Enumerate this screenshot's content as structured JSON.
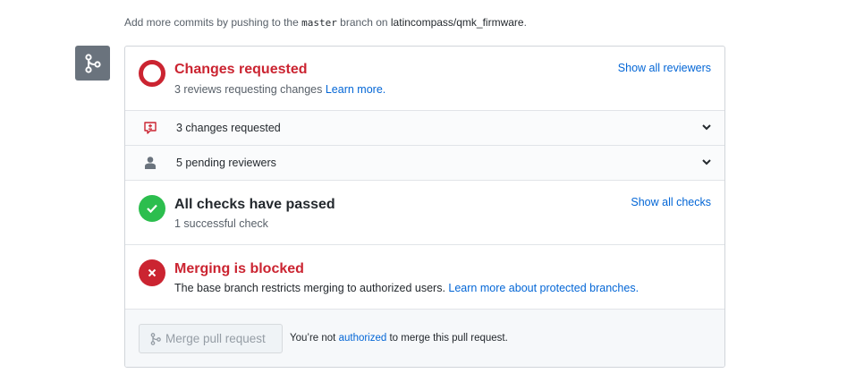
{
  "top_note": {
    "prefix": "Add more commits by pushing to the ",
    "branch": "master",
    "middle": " branch on ",
    "repo": "latincompass/qmk_firmware",
    "suffix": "."
  },
  "changes_requested": {
    "title": "Changes requested",
    "subtitle": "3 reviews requesting changes ",
    "learn_more": "Learn more.",
    "show_all": "Show all reviewers"
  },
  "rows": {
    "changes": "3 changes requested",
    "reviewers": "5 pending reviewers"
  },
  "checks": {
    "title": "All checks have passed",
    "subtitle": "1 successful check",
    "show_all": "Show all checks"
  },
  "blocked": {
    "title": "Merging is blocked",
    "subtitle": "The base branch restricts merging to authorized users. ",
    "learn_more": "Learn more about protected branches."
  },
  "merge": {
    "button": "Merge pull request",
    "note_prefix": "You’re not ",
    "note_link": "authorized",
    "note_suffix": " to merge this pull request."
  },
  "colors": {
    "red": "#cb2431",
    "green": "#2cbe4e",
    "link": "#0366d6",
    "gray_icon": "#6a737d"
  },
  "icons": {
    "merge": "git-merge-icon",
    "changes": "comment-diff-icon",
    "reviewers": "person-icon",
    "chevron": "chevron-down-icon",
    "check": "check-icon",
    "x": "x-icon"
  }
}
